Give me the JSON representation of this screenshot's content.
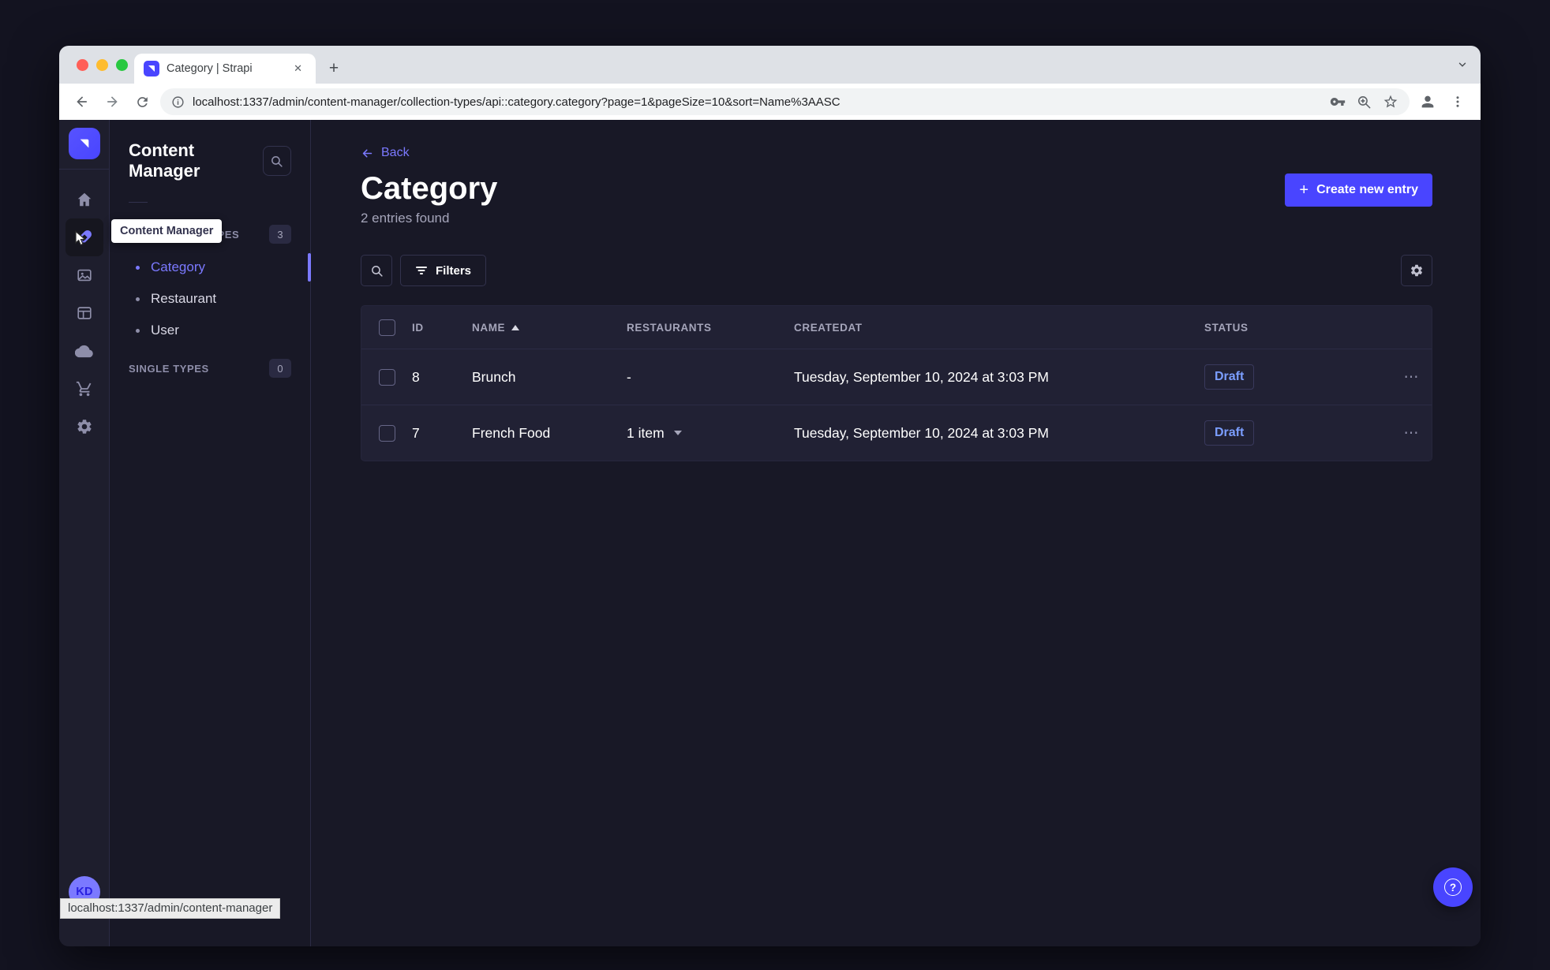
{
  "browser": {
    "tab_title": "Category | Strapi",
    "url": "localhost:1337/admin/content-manager/collection-types/api::category.category?page=1&pageSize=10&sort=Name%3AASC"
  },
  "icons": {
    "close": "✕",
    "plus": "+",
    "kebab": "⋯",
    "question": "?"
  },
  "nav": {
    "avatar": "KD"
  },
  "sidebar": {
    "title": "Content Manager",
    "tooltip": "Content Manager",
    "collection_types": {
      "label": "COLLECTION TYPES",
      "count": "3",
      "items": [
        {
          "label": "Category",
          "active": true
        },
        {
          "label": "Restaurant",
          "active": false
        },
        {
          "label": "User",
          "active": false
        }
      ]
    },
    "single_types": {
      "label": "SINGLE TYPES",
      "count": "0"
    }
  },
  "main": {
    "back": "Back",
    "title": "Category",
    "subtitle": "2 entries found",
    "create_button": "Create new entry",
    "filters_button": "Filters",
    "table": {
      "headers": {
        "id": "ID",
        "name": "NAME",
        "restaurants": "RESTAURANTS",
        "createdat": "CREATEDAT",
        "status": "STATUS"
      },
      "rows": [
        {
          "id": "8",
          "name": "Brunch",
          "restaurants": "-",
          "createdat": "Tuesday, September 10, 2024 at 3:03 PM",
          "status": "Draft"
        },
        {
          "id": "7",
          "name": "French Food",
          "restaurants": "1 item",
          "createdat": "Tuesday, September 10, 2024 at 3:03 PM",
          "status": "Draft"
        }
      ]
    }
  },
  "status_bar": "localhost:1337/admin/content-manager",
  "colors": {
    "primary": "#4945ff",
    "primary_light": "#7b79ff",
    "draft_status": "#7b9eff",
    "app_background": "#181826",
    "card_background": "#212134"
  }
}
